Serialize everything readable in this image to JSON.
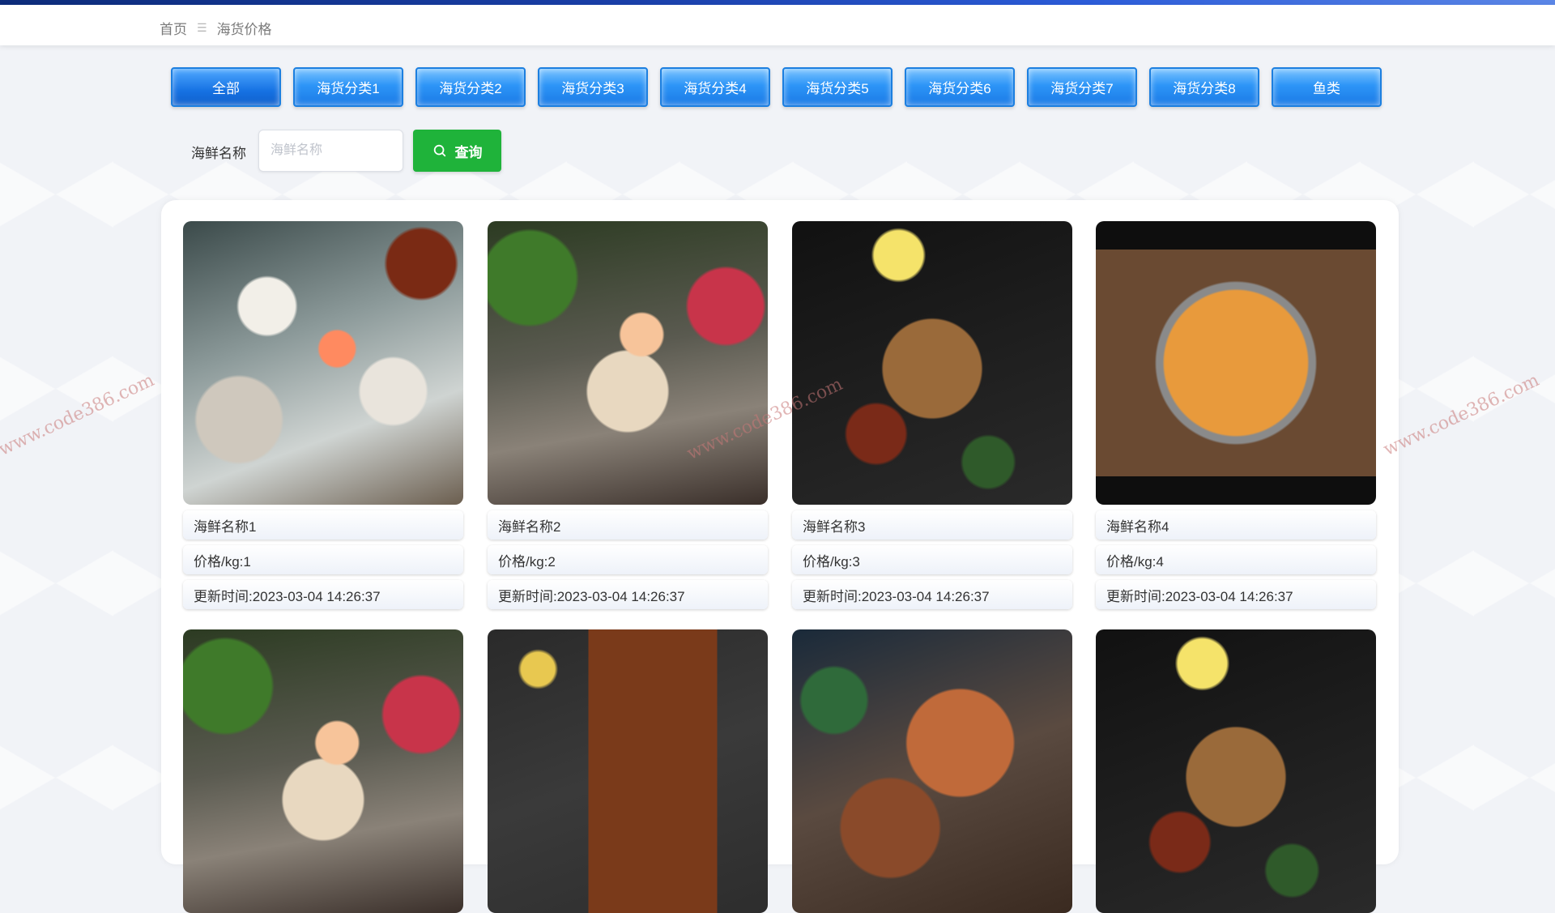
{
  "breadcrumb": {
    "home": "首页",
    "separator": "☰",
    "current": "海货价格"
  },
  "categories": [
    "全部",
    "海货分类1",
    "海货分类2",
    "海货分类3",
    "海货分类4",
    "海货分类5",
    "海货分类6",
    "海货分类7",
    "海货分类8",
    "鱼类"
  ],
  "active_category": "全部",
  "search": {
    "label": "海鲜名称",
    "placeholder": "海鲜名称",
    "value": "",
    "button_label": "查询"
  },
  "products": [
    {
      "name": "海鲜名称1",
      "price": "价格/kg:1",
      "updated": "更新时间:2023-03-04 14:26:37",
      "image": "seafood-platter-photo"
    },
    {
      "name": "海鲜名称2",
      "price": "价格/kg:2",
      "updated": "更新时间:2023-03-04 14:26:37",
      "image": "hotpot-photo"
    },
    {
      "name": "海鲜名称3",
      "price": "价格/kg:3",
      "updated": "更新时间:2023-03-04 14:26:37",
      "image": "crab-photo"
    },
    {
      "name": "海鲜名称4",
      "price": "价格/kg:4",
      "updated": "更新时间:2023-03-04 14:26:37",
      "image": "seafood-pan-photo"
    },
    {
      "name": "",
      "price": "",
      "updated": "",
      "image": "hotpot-photo"
    },
    {
      "name": "",
      "price": "",
      "updated": "",
      "image": "seafood-tray-photo"
    },
    {
      "name": "",
      "price": "",
      "updated": "",
      "image": "grilled-seafood-photo"
    },
    {
      "name": "",
      "price": "",
      "updated": "",
      "image": "crab-photo"
    }
  ],
  "watermark": "www.code386.com",
  "colors": {
    "accent": "#1a7ae6",
    "query_button": "#1fb33a",
    "top_strip": "#1a3fa8"
  }
}
